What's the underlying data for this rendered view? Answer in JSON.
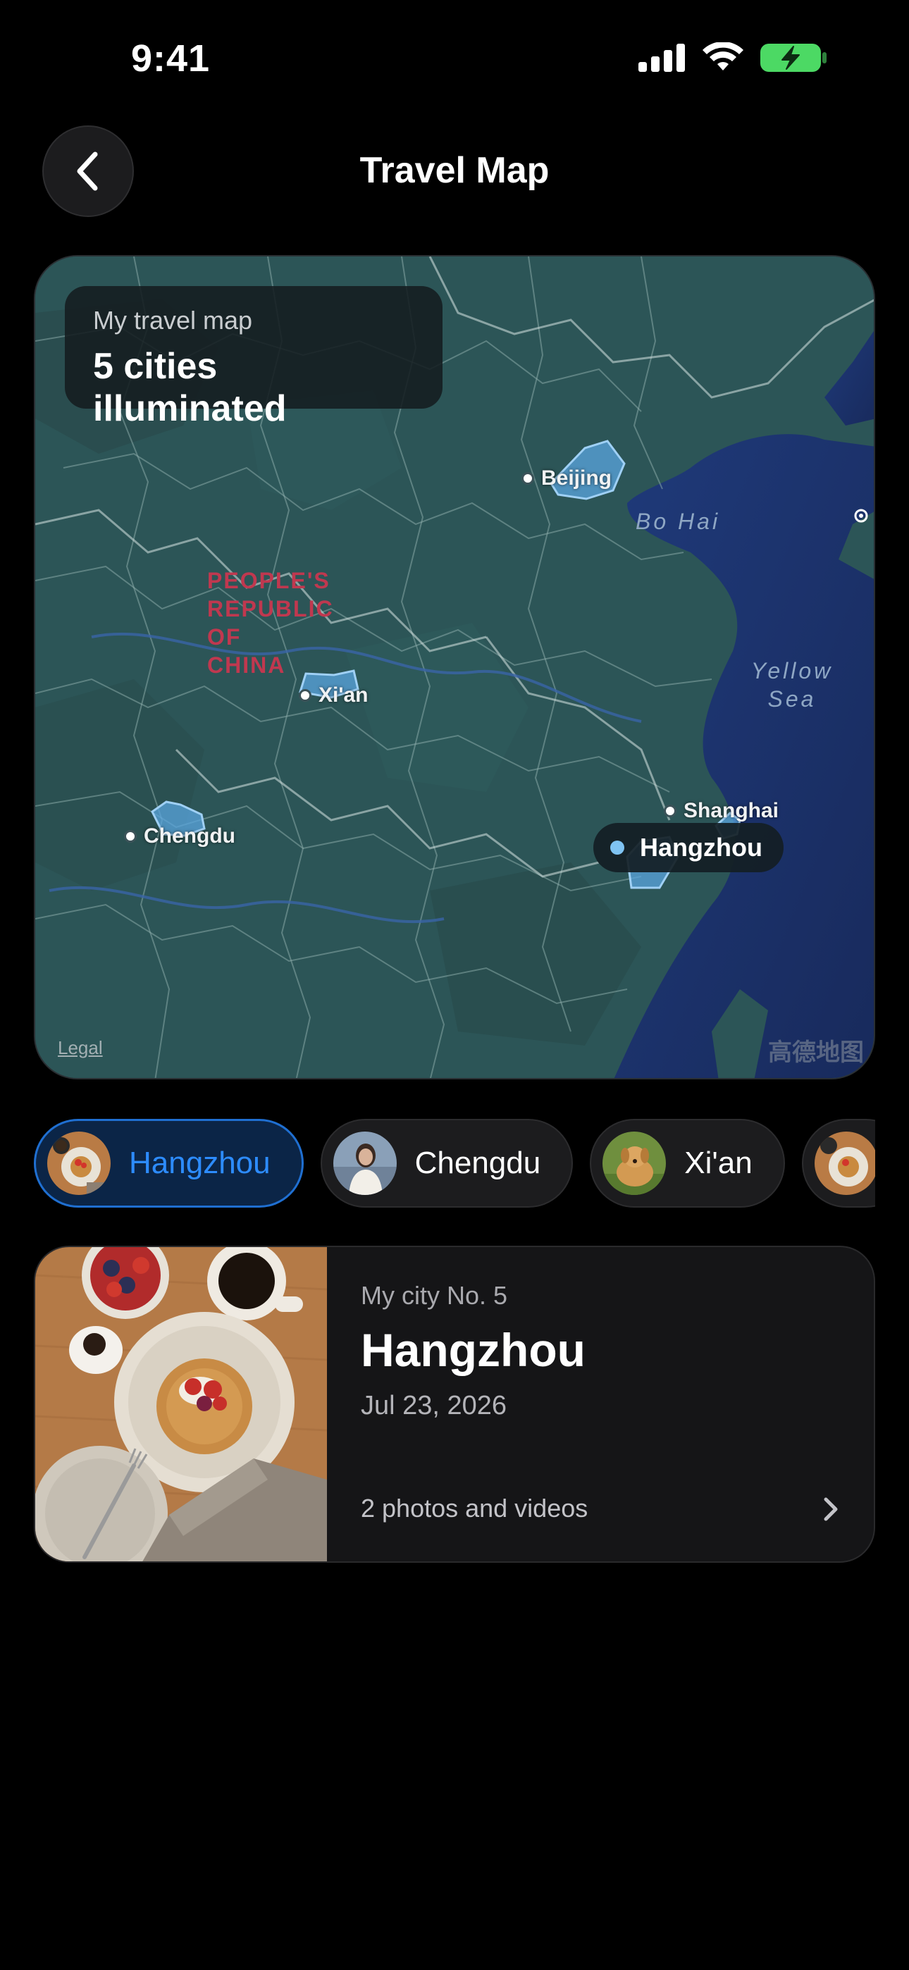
{
  "status_bar": {
    "time": "9:41"
  },
  "header": {
    "title": "Travel Map",
    "back_icon": "chevron-left-icon"
  },
  "map": {
    "summary_subtitle": "My travel map",
    "summary_title": "5 cities illuminated",
    "country_label": "PEOPLE'S REPUBLIC OF CHINA",
    "seas": [
      "Bo Hai",
      "Yellow Sea"
    ],
    "cities": [
      {
        "name": "Beijing"
      },
      {
        "name": "Xi'an"
      },
      {
        "name": "Chengdu"
      },
      {
        "name": "Shanghai"
      },
      {
        "name": "Hangzhou",
        "selected": true
      }
    ],
    "legal_label": "Legal",
    "watermark": "高德地图",
    "colors": {
      "land": "#2c5557",
      "sea": "#1c2f6b",
      "highlight": "#5aa6df",
      "country_label": "#c0384f"
    }
  },
  "city_pills": [
    {
      "label": "Hangzhou",
      "active": true
    },
    {
      "label": "Chengdu",
      "active": false
    },
    {
      "label": "Xi'an",
      "active": false
    }
  ],
  "detail": {
    "subtitle": "My city No. 5",
    "city": "Hangzhou",
    "date": "Jul 23, 2026",
    "media_count": "2 photos and videos"
  },
  "accent_color": "#2d8cff"
}
